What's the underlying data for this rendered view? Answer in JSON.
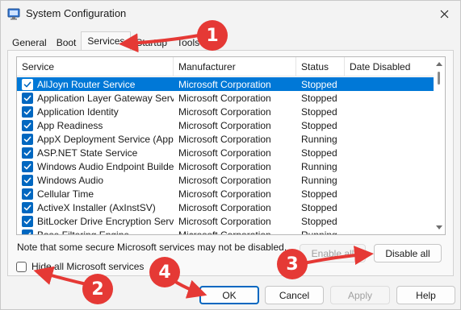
{
  "window": {
    "title": "System Configuration",
    "icon": "system-config-icon",
    "close_icon": "close-icon"
  },
  "tabs": [
    {
      "label": "General",
      "active": false
    },
    {
      "label": "Boot",
      "active": false
    },
    {
      "label": "Services",
      "active": true
    },
    {
      "label": "Startup",
      "active": false
    },
    {
      "label": "Tools",
      "active": false
    }
  ],
  "services_table": {
    "columns": [
      "Service",
      "Manufacturer",
      "Status",
      "Date Disabled"
    ],
    "rows": [
      {
        "checked": true,
        "selected": true,
        "service": "AllJoyn Router Service",
        "manufacturer": "Microsoft Corporation",
        "status": "Stopped",
        "date_disabled": ""
      },
      {
        "checked": true,
        "selected": false,
        "service": "Application Layer Gateway Service",
        "manufacturer": "Microsoft Corporation",
        "status": "Stopped",
        "date_disabled": ""
      },
      {
        "checked": true,
        "selected": false,
        "service": "Application Identity",
        "manufacturer": "Microsoft Corporation",
        "status": "Stopped",
        "date_disabled": ""
      },
      {
        "checked": true,
        "selected": false,
        "service": "App Readiness",
        "manufacturer": "Microsoft Corporation",
        "status": "Stopped",
        "date_disabled": ""
      },
      {
        "checked": true,
        "selected": false,
        "service": "AppX Deployment Service (AppX...",
        "manufacturer": "Microsoft Corporation",
        "status": "Running",
        "date_disabled": ""
      },
      {
        "checked": true,
        "selected": false,
        "service": "ASP.NET State Service",
        "manufacturer": "Microsoft Corporation",
        "status": "Stopped",
        "date_disabled": ""
      },
      {
        "checked": true,
        "selected": false,
        "service": "Windows Audio Endpoint Builder",
        "manufacturer": "Microsoft Corporation",
        "status": "Running",
        "date_disabled": ""
      },
      {
        "checked": true,
        "selected": false,
        "service": "Windows Audio",
        "manufacturer": "Microsoft Corporation",
        "status": "Running",
        "date_disabled": ""
      },
      {
        "checked": true,
        "selected": false,
        "service": "Cellular Time",
        "manufacturer": "Microsoft Corporation",
        "status": "Stopped",
        "date_disabled": ""
      },
      {
        "checked": true,
        "selected": false,
        "service": "ActiveX Installer (AxInstSV)",
        "manufacturer": "Microsoft Corporation",
        "status": "Stopped",
        "date_disabled": ""
      },
      {
        "checked": true,
        "selected": false,
        "service": "BitLocker Drive Encryption Service",
        "manufacturer": "Microsoft Corporation",
        "status": "Stopped",
        "date_disabled": ""
      },
      {
        "checked": true,
        "selected": false,
        "service": "Base Filtering Engine",
        "manufacturer": "Microsoft Corporation",
        "status": "Running",
        "date_disabled": ""
      }
    ]
  },
  "note": "Note that some secure Microsoft services may not be disabled.",
  "buttons": {
    "enable_all": "Enable all",
    "disable_all": "Disable all",
    "ok": "OK",
    "cancel": "Cancel",
    "apply": "Apply",
    "help": "Help"
  },
  "hide_ms_services": {
    "label": "Hide all Microsoft services",
    "checked": false
  },
  "annotations": [
    "1",
    "2",
    "3",
    "4"
  ],
  "colors": {
    "accent": "#0067c0",
    "selection": "#0078d7",
    "annotation": "#e53935"
  }
}
